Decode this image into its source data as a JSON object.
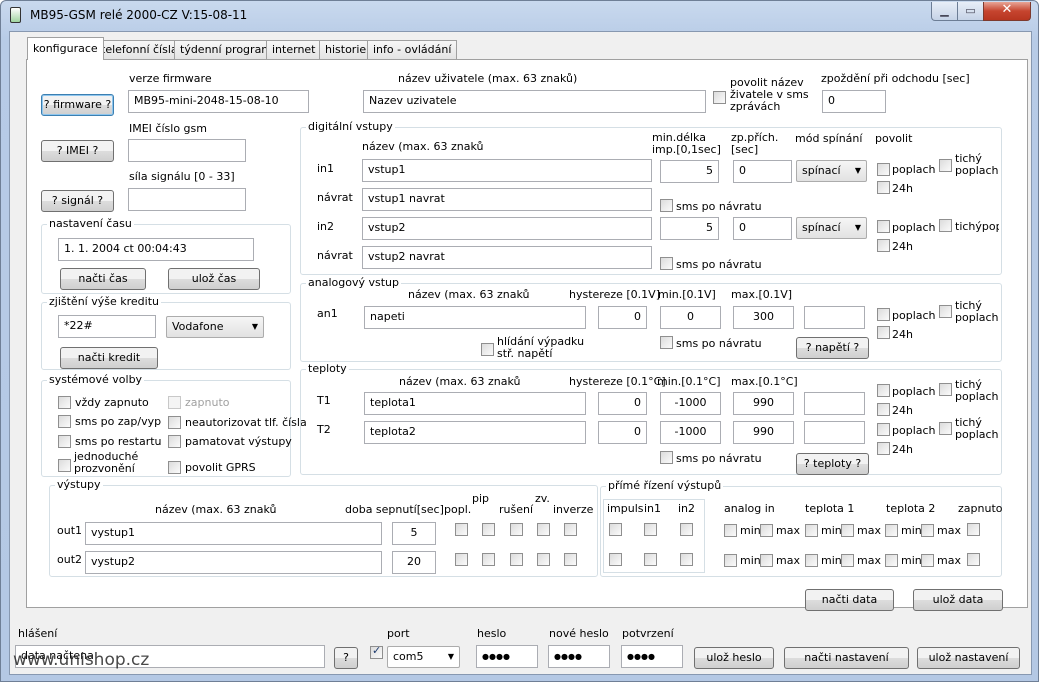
{
  "window": {
    "title": "MB95-GSM relé 2000-CZ V:15-08-11"
  },
  "tabs": [
    "konfigurace",
    "telefonní čísla",
    "týdenní program",
    "internet",
    "historie",
    "info - ovládání"
  ],
  "firmware": {
    "label": "verze firmware",
    "value": "MB95-mini-2048-15-08-10",
    "button": "? firmware ?"
  },
  "imei": {
    "label": "IMEI číslo gsm",
    "value": "",
    "button": "? IMEI ?"
  },
  "signal": {
    "label": "síla signálu [0 - 33]",
    "value": "",
    "button": "? signál ?"
  },
  "user": {
    "label": "název uživatele (max. 63 znaků)",
    "value": "Nazev uzivatele",
    "sms_checkbox": "povolit název živatele v sms zprávách"
  },
  "delay": {
    "label": "zpoždění při odchodu [sec]",
    "value": "0"
  },
  "time": {
    "title": "nastavení času",
    "value": "1. 1. 2004  ct 00:04:43",
    "read": "načti čas",
    "save": "ulož čas"
  },
  "credit": {
    "title": "zjištění výše kreditu",
    "code": "*22#",
    "operator": "Vodafone",
    "read": "načti kredit"
  },
  "system": {
    "title": "systémové volby",
    "items": [
      "vždy zapnuto",
      "zapnuto",
      "sms po zap/vyp",
      "neautorizovat tlf. čísla",
      "sms po restartu",
      "pamatovat výstupy",
      "jednoduché prozvonění",
      "povolit GPRS"
    ]
  },
  "digital": {
    "title": "digitální vstupy",
    "h_name": "název (max.  63 znaků",
    "h_min": "min.délka imp.[0,1sec]",
    "h_zp": "zp.přích. [sec]",
    "h_mode": "mód spínání",
    "h_enable": "povolit",
    "rows": [
      {
        "label": "in1",
        "name": "vstup1",
        "min": "5",
        "zp": "0",
        "mode": "spínací",
        "return_label": "návrat",
        "return": "vstup1 navrat",
        "cb1": "poplach",
        "cb2": "tichý poplach",
        "cb3": "24h",
        "sms": "sms po návratu"
      },
      {
        "label": "in2",
        "name": "vstup2",
        "min": "5",
        "zp": "0",
        "mode": "spínací",
        "return_label": "návrat",
        "return": "vstup2 navrat",
        "cb1": "poplach",
        "cb2": "tichýpop",
        "cb3": "24h",
        "sms": "sms po návratu"
      }
    ]
  },
  "analog": {
    "title": "analogový vstup",
    "h_name": "název (max.  63 znaků",
    "h_hyst": "hystereze [0.1V]",
    "h_min": "min.[0.1V]",
    "h_max": "max.[0.1V]",
    "label": "an1",
    "name": "napeti",
    "hyst": "0",
    "min": "0",
    "max": "300",
    "extra": "",
    "watch": "hlídání výpadku stř. napětí",
    "sms": "sms po návratu",
    "cb1": "poplach",
    "cb2": "tichý poplach",
    "cb3": "24h",
    "button": "? napětí ?"
  },
  "temps": {
    "title": "teploty",
    "h_name": "název (max.  63 znaků",
    "h_hyst": "hystereze [0.1°C]",
    "h_min": "min.[0.1°C]",
    "h_max": "max.[0.1°C]",
    "rows": [
      {
        "label": "T1",
        "name": "teplota1",
        "hyst": "0",
        "min": "-1000",
        "max": "990",
        "extra": "",
        "cb1": "poplach",
        "cb2": "tichý poplach",
        "cb3": "24h"
      },
      {
        "label": "T2",
        "name": "teplota2",
        "hyst": "0",
        "min": "-1000",
        "max": "990",
        "extra": "",
        "cb1": "poplach",
        "cb2": "tichý poplach",
        "cb3": "24h"
      }
    ],
    "sms": "sms po návratu",
    "button": "? teploty ?"
  },
  "outputs": {
    "title": "výstupy",
    "h_name": "název (max.  63 znaků",
    "h_time": "doba sepnutí[sec]",
    "h_popl": "popl.",
    "h_pip": "pip",
    "h_ruseni": "rušení",
    "h_zv": "zv.",
    "h_inverze": "inverze",
    "rows": [
      {
        "label": "out1",
        "name": "vystup1",
        "time": "5"
      },
      {
        "label": "out2",
        "name": "vystup2",
        "time": "20"
      }
    ]
  },
  "direct": {
    "title": "přímé řízení výstupů",
    "h_impuls": "impuls",
    "h_in1": "in1",
    "h_in2": "in2",
    "h_analog": "analog in",
    "h_t1": "teplota 1",
    "h_t2": "teplota 2",
    "h_on": "zapnuto",
    "min": "min",
    "max": "max"
  },
  "actions": {
    "read": "načti data",
    "save": "ulož data"
  },
  "status": {
    "report_label": "hlášení",
    "report": "data načtena",
    "q": "?",
    "port_label": "port",
    "port": "com5",
    "pass_label": "heslo",
    "pass": "●●●●",
    "new_label": "nové heslo",
    "new": "●●●●",
    "confirm_label": "potvrzení",
    "confirm": "●●●●",
    "save_pass": "ulož heslo",
    "read_settings": "načti nastavení",
    "save_settings": "ulož nastavení"
  },
  "watermark": "www.unishop.cz"
}
